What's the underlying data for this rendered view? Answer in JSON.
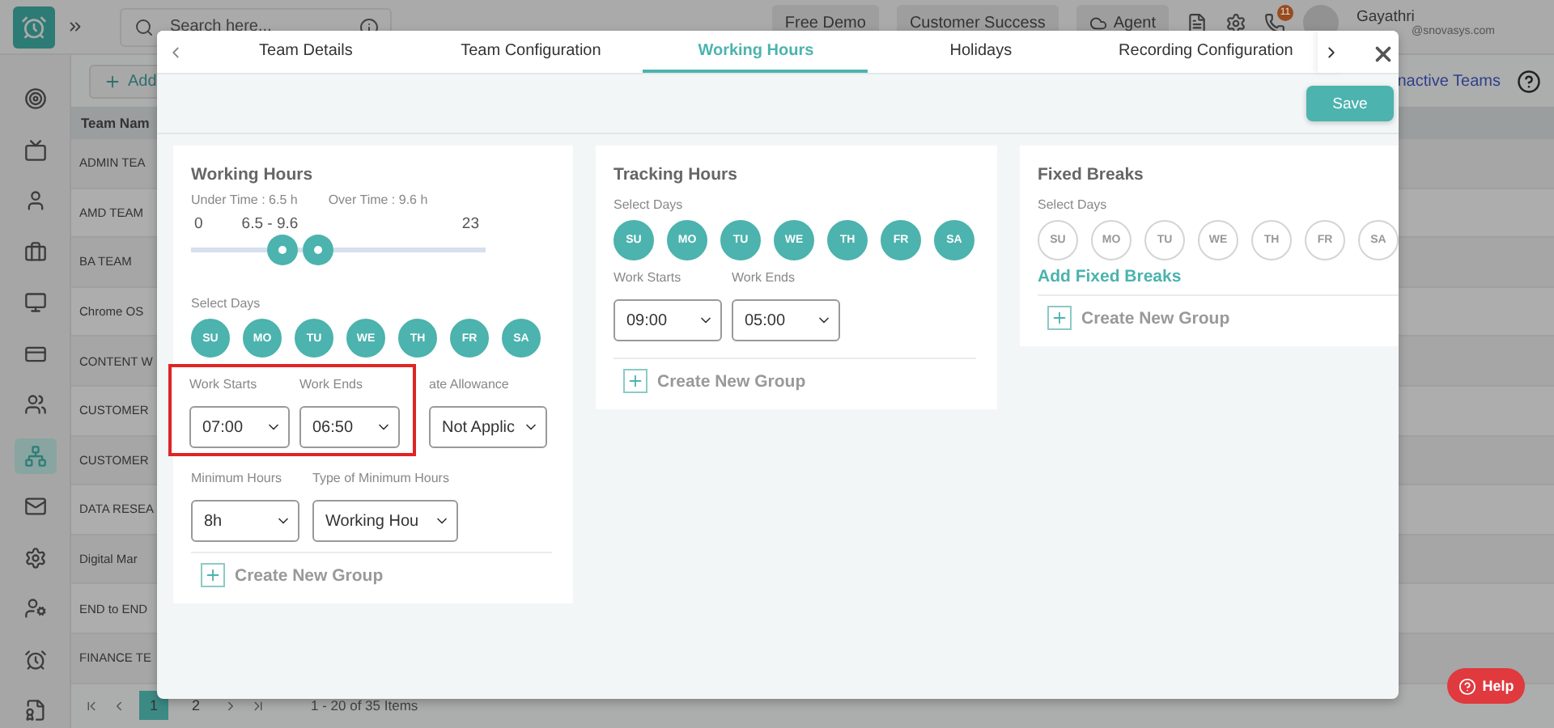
{
  "app": {
    "search": {
      "placeholder": "Search here..."
    },
    "chips": [
      {
        "label": "Free Demo",
        "kind": "plain"
      },
      {
        "label": "Customer Success",
        "kind": "plain"
      },
      {
        "label": "Agent",
        "kind": "cloud"
      }
    ],
    "notification_badge": "11",
    "user": {
      "name": "Gayathri",
      "email": "@snovasys.com"
    },
    "add_button": "Add",
    "inactive_link": "nactive Teams",
    "sidebar": {
      "items": [
        {
          "selected": false
        },
        {
          "selected": false
        },
        {
          "selected": false
        },
        {
          "selected": false
        },
        {
          "selected": false
        },
        {
          "selected": false
        },
        {
          "selected": false
        },
        {
          "selected": true
        },
        {
          "selected": false
        },
        {
          "selected": false
        },
        {
          "selected": false
        },
        {
          "selected": false
        },
        {
          "selected": false
        }
      ]
    },
    "table": {
      "columns": [
        "Team Nam"
      ],
      "rows": [
        "ADMIN TEA",
        "AMD TEAM",
        "BA TEAM",
        "Chrome OS",
        "CONTENT W",
        "CUSTOMER",
        "CUSTOMER",
        "DATA RESEA",
        "Digital Mar",
        "END to END",
        "FINANCE TE"
      ]
    },
    "pagination": {
      "pages": [
        {
          "label": "1",
          "selected": true
        },
        {
          "label": "2",
          "selected": false
        }
      ],
      "summary": "1 - 20 of 35 Items"
    },
    "help_button": "Help"
  },
  "modal": {
    "tabs": [
      {
        "label": "Team Details",
        "selected": false
      },
      {
        "label": "Team Configuration",
        "selected": false
      },
      {
        "label": "Working Hours",
        "selected": true
      },
      {
        "label": "Holidays",
        "selected": false
      },
      {
        "label": "Recording Configuration",
        "selected": false
      }
    ],
    "save_button": "Save",
    "working_hours": {
      "title": "Working Hours",
      "under_time": "Under Time : 6.5 h",
      "over_time": "Over Time : 9.6 h",
      "slider": {
        "min": "0",
        "range": "6.5 - 9.6",
        "max": "23",
        "thumbs": [
          {
            "level": 0.31
          },
          {
            "level": 0.43
          }
        ]
      },
      "days_label": "Select Days",
      "days": [
        {
          "label": "SU",
          "selected": true
        },
        {
          "label": "MO",
          "selected": true
        },
        {
          "label": "TU",
          "selected": true
        },
        {
          "label": "WE",
          "selected": true
        },
        {
          "label": "TH",
          "selected": true
        },
        {
          "label": "FR",
          "selected": true
        },
        {
          "label": "SA",
          "selected": true
        }
      ],
      "fields": [
        {
          "label": "Work Starts",
          "value": "07:00",
          "highlighted": true
        },
        {
          "label": "Work Ends",
          "value": "06:50",
          "highlighted": true
        },
        {
          "label": "ate Allowance",
          "value": "Not Applic",
          "highlighted": false
        }
      ],
      "more_fields": [
        {
          "label": "Minimum Hours",
          "value": "8h"
        },
        {
          "label": "Type of Minimum Hours",
          "value": "Working Hou"
        }
      ],
      "create_group": "Create New Group"
    },
    "tracking_hours": {
      "title": "Tracking Hours",
      "days_label": "Select Days",
      "days": [
        {
          "label": "SU",
          "selected": true
        },
        {
          "label": "MO",
          "selected": true
        },
        {
          "label": "TU",
          "selected": true
        },
        {
          "label": "WE",
          "selected": true
        },
        {
          "label": "TH",
          "selected": true
        },
        {
          "label": "FR",
          "selected": true
        },
        {
          "label": "SA",
          "selected": true
        }
      ],
      "fields": [
        {
          "label": "Work Starts",
          "value": "09:00"
        },
        {
          "label": "Work Ends",
          "value": "05:00"
        }
      ],
      "create_group": "Create New Group"
    },
    "fixed_breaks": {
      "title": "Fixed Breaks",
      "days_label": "Select Days",
      "days": [
        {
          "label": "SU",
          "selected": false
        },
        {
          "label": "MO",
          "selected": false
        },
        {
          "label": "TU",
          "selected": false
        },
        {
          "label": "WE",
          "selected": false
        },
        {
          "label": "TH",
          "selected": false
        },
        {
          "label": "FR",
          "selected": false
        },
        {
          "label": "SA",
          "selected": false
        }
      ],
      "add_link": "Add Fixed Breaks",
      "create_group": "Create New Group"
    }
  }
}
